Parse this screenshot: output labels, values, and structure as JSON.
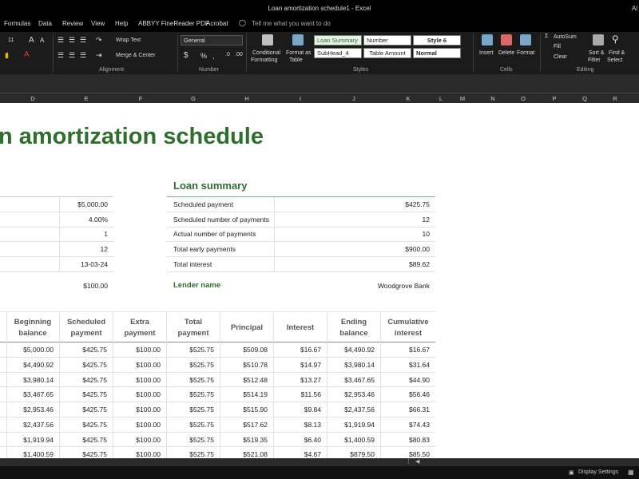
{
  "window": {
    "title": "Loan amortization schedule1  -  Excel",
    "user_initials": "Al"
  },
  "tabs": [
    "Formulas",
    "Data",
    "Review",
    "View",
    "Help",
    "ABBYY FineReader PDF",
    "Acrobat"
  ],
  "tell_me": "Tell me what you want to do",
  "ribbon": {
    "font_size": "11",
    "wrap_text": "Wrap Text",
    "merge_center": "Merge & Center",
    "number_format": "General",
    "conditional": [
      "Conditional",
      "Formatting"
    ],
    "format_table": [
      "Format as",
      "Table"
    ],
    "styles": [
      "Loan Summary",
      "Number",
      "Style 6",
      "SubHead_4",
      "Table Amount",
      "Normal"
    ],
    "cells_buttons": [
      "Insert",
      "Delete",
      "Format"
    ],
    "autosum": "AutoSum",
    "fill": "Fill",
    "clear": "Clear",
    "sort_filter": [
      "Sort &",
      "Filter"
    ],
    "find_select": [
      "Find &",
      "Select"
    ],
    "groups": [
      "Alignment",
      "Number",
      "Styles",
      "Cells",
      "Editing"
    ]
  },
  "columns": [
    "D",
    "E",
    "F",
    "G",
    "H",
    "I",
    "J",
    "K",
    "L",
    "M",
    "N",
    "O",
    "P",
    "Q",
    "R"
  ],
  "sheet": {
    "title": "n amortization schedule",
    "left_values": [
      "$5,000.00",
      "4.00%",
      "1",
      "12",
      "13-03-24"
    ],
    "extra_value": "$100.00",
    "loan_summary_title": "Loan summary",
    "summary": [
      {
        "label": "Scheduled payment",
        "value": "$425.75"
      },
      {
        "label": "Scheduled number of payments",
        "value": "12"
      },
      {
        "label": "Actual number of payments",
        "value": "10"
      },
      {
        "label": "Total early payments",
        "value": "$900.00"
      },
      {
        "label": "Total interest",
        "value": "$89.62"
      }
    ],
    "lender_label": "Lender name",
    "lender_value": "Woodgrove Bank",
    "headers": [
      [
        "Beginning",
        "balance"
      ],
      [
        "Scheduled",
        "payment"
      ],
      [
        "Extra",
        "payment"
      ],
      [
        "Total",
        "payment"
      ],
      [
        "Principal"
      ],
      [
        "Interest"
      ],
      [
        "Ending",
        "balance"
      ],
      [
        "Cumulative",
        "interest"
      ]
    ],
    "rows": [
      [
        "$5,000.00",
        "$425.75",
        "$100.00",
        "$525.75",
        "$509.08",
        "$16.67",
        "$4,490.92",
        "$16.67"
      ],
      [
        "$4,490.92",
        "$425.75",
        "$100.00",
        "$525.75",
        "$510.78",
        "$14.97",
        "$3,980.14",
        "$31.64"
      ],
      [
        "$3,980.14",
        "$425.75",
        "$100.00",
        "$525.75",
        "$512.48",
        "$13.27",
        "$3,467.65",
        "$44.90"
      ],
      [
        "$3,467.65",
        "$425.75",
        "$100.00",
        "$525.75",
        "$514.19",
        "$11.56",
        "$2,953.46",
        "$56.46"
      ],
      [
        "$2,953.46",
        "$425.75",
        "$100.00",
        "$525.75",
        "$515.90",
        "$9.84",
        "$2,437.56",
        "$66.31"
      ],
      [
        "$2,437.56",
        "$425.75",
        "$100.00",
        "$525.75",
        "$517.62",
        "$8.13",
        "$1,919.94",
        "$74.43"
      ],
      [
        "$1,919.94",
        "$425.75",
        "$100.00",
        "$525.75",
        "$519.35",
        "$6.40",
        "$1,400.59",
        "$80.83"
      ],
      [
        "$1,400.59",
        "$425.75",
        "$100.00",
        "$525.75",
        "$521.08",
        "$4.67",
        "$879.50",
        "$85.50"
      ]
    ]
  },
  "status": {
    "display_settings": "Display Settings"
  }
}
